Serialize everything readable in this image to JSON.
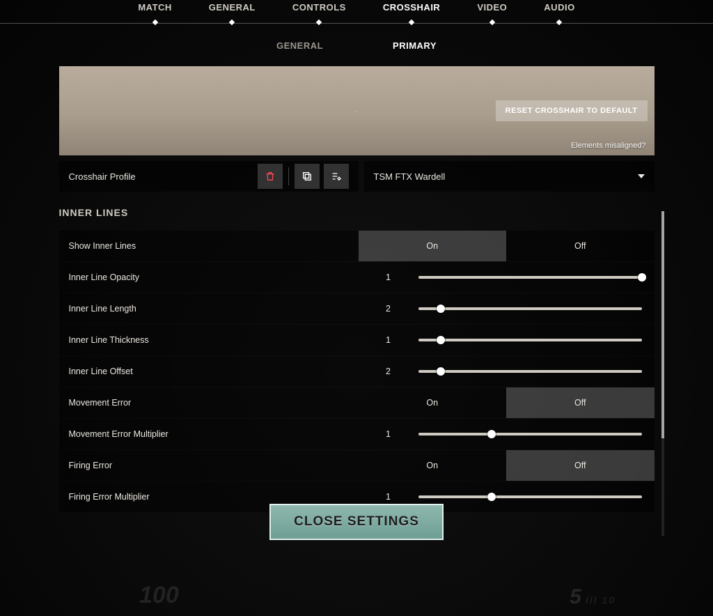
{
  "topTabs": [
    "MATCH",
    "GENERAL",
    "CONTROLS",
    "CROSSHAIR",
    "VIDEO",
    "AUDIO"
  ],
  "topActiveIndex": 3,
  "subTabs": [
    "GENERAL",
    "PRIMARY"
  ],
  "subActiveIndex": 1,
  "preview": {
    "resetLabel": "RESET CROSSHAIR TO DEFAULT",
    "misaligned": "Elements misaligned?"
  },
  "profile": {
    "label": "Crosshair Profile",
    "selected": "TSM FTX Wardell"
  },
  "sectionTitle": "INNER LINES",
  "toggleLabels": {
    "on": "On",
    "off": "Off"
  },
  "settings": [
    {
      "type": "toggle",
      "label": "Show Inner Lines",
      "value": "on"
    },
    {
      "type": "slider",
      "label": "Inner Line Opacity",
      "value": "1",
      "pos": 100
    },
    {
      "type": "slider",
      "label": "Inner Line Length",
      "value": "2",
      "pos": 10
    },
    {
      "type": "slider",
      "label": "Inner Line Thickness",
      "value": "1",
      "pos": 10
    },
    {
      "type": "slider",
      "label": "Inner Line Offset",
      "value": "2",
      "pos": 10
    },
    {
      "type": "toggle",
      "label": "Movement Error",
      "value": "off"
    },
    {
      "type": "slider",
      "label": "Movement Error Multiplier",
      "value": "1",
      "pos": 33
    },
    {
      "type": "toggle",
      "label": "Firing Error",
      "value": "off"
    },
    {
      "type": "slider",
      "label": "Firing Error Multiplier",
      "value": "1",
      "pos": 33
    }
  ],
  "closeLabel": "CLOSE SETTINGS",
  "hud": {
    "hp": "100",
    "mag": "5",
    "reserve": "III 10"
  }
}
